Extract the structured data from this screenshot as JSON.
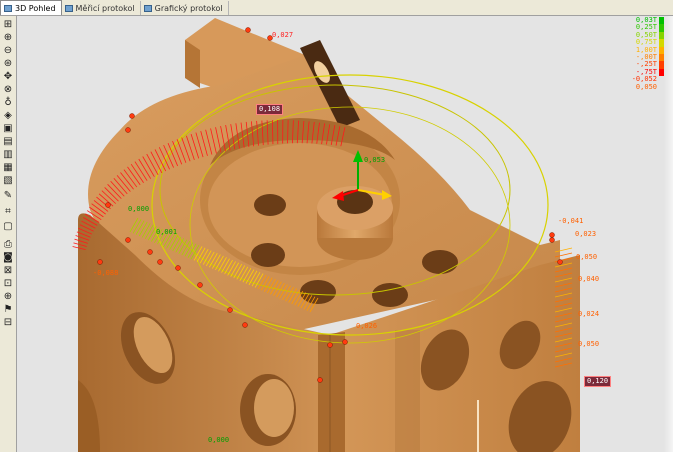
{
  "tabs": [
    {
      "label": "3D Pohled",
      "icon": "view-3d-icon"
    },
    {
      "label": "Měřicí protokol",
      "icon": "protocol-icon"
    },
    {
      "label": "Grafický protokol",
      "icon": "graphic-protocol-icon"
    }
  ],
  "toolbar": [
    {
      "name": "zoom-fit-icon",
      "glyph": "⊞"
    },
    {
      "name": "zoom-in-icon",
      "glyph": "⊕"
    },
    {
      "name": "zoom-out-icon",
      "glyph": "⊖"
    },
    {
      "name": "rotate-icon",
      "glyph": "⊛"
    },
    {
      "name": "pan-icon",
      "glyph": "✥"
    },
    {
      "name": "orbit-icon",
      "glyph": "⊗"
    },
    {
      "name": "light-icon",
      "glyph": "♁"
    },
    {
      "name": "view-iso-icon",
      "glyph": "◈"
    },
    {
      "name": "view-front-icon",
      "glyph": "▣"
    },
    {
      "name": "view-top-icon",
      "glyph": "▤"
    },
    {
      "name": "view-side-icon",
      "glyph": "▥"
    },
    {
      "name": "view-back-icon",
      "glyph": "▦"
    },
    {
      "name": "view-bottom-icon",
      "glyph": "▧"
    },
    {
      "name": "cursor-icon",
      "glyph": "✎"
    },
    {
      "name": "measure-icon",
      "glyph": "⌗"
    },
    {
      "name": "select-icon",
      "glyph": "▢"
    },
    {
      "name": "print-icon",
      "glyph": "⎙"
    },
    {
      "name": "camera-icon",
      "glyph": "◙"
    },
    {
      "name": "delete-icon",
      "glyph": "⊠"
    },
    {
      "name": "export-icon",
      "glyph": "⊡"
    },
    {
      "name": "target-icon",
      "glyph": "⊕"
    },
    {
      "name": "flag-icon",
      "glyph": "⚑"
    },
    {
      "name": "report-icon",
      "glyph": "⊟"
    }
  ],
  "legend": {
    "rows": [
      {
        "label": "0,03T",
        "color": "#00c000"
      },
      {
        "label": "0,25T",
        "color": "#2ec800"
      },
      {
        "label": "0,50T",
        "color": "#86d400"
      },
      {
        "label": "0,75T",
        "color": "#d4d800"
      },
      {
        "label": "1,00T",
        "color": "#ffb000"
      },
      {
        "label": "-,00T",
        "color": "#ff8000"
      },
      {
        "label": "-,25T",
        "color": "#ff4000"
      },
      {
        "label": "-,75T",
        "color": "#ff0000"
      }
    ],
    "extra": [
      "-0,052",
      "0,050"
    ]
  },
  "labels": [
    {
      "name": "label-top",
      "text": "0,027",
      "color": "#ff2020"
    },
    {
      "name": "label-center",
      "text": "0,053",
      "color": "#00a000"
    },
    {
      "name": "label-left-1",
      "text": "0,000",
      "color": "#00a000"
    },
    {
      "name": "label-left-2",
      "text": "0,001",
      "color": "#00a000"
    },
    {
      "name": "label-left-3",
      "text": "-0,088",
      "color": "#ff6000"
    },
    {
      "name": "label-right-1",
      "text": "-0,041",
      "color": "#ff6000"
    },
    {
      "name": "label-right-2",
      "text": "0,023",
      "color": "#ff6000"
    },
    {
      "name": "label-right-3",
      "text": "0,050",
      "color": "#ff6000"
    },
    {
      "name": "label-right-4",
      "text": "0,040",
      "color": "#ff6000"
    },
    {
      "name": "label-right-5",
      "text": "0,024",
      "color": "#ff6000"
    },
    {
      "name": "label-right-6",
      "text": "0,050",
      "color": "#ff6000"
    },
    {
      "name": "label-mid",
      "text": "0,026",
      "color": "#ff6000"
    },
    {
      "name": "label-bottom",
      "text": "0,000",
      "color": "#00a000"
    }
  ],
  "boxed_labels": [
    {
      "name": "tag-arc",
      "text": "0,108"
    },
    {
      "name": "tag-right",
      "text": "0,120"
    }
  ]
}
